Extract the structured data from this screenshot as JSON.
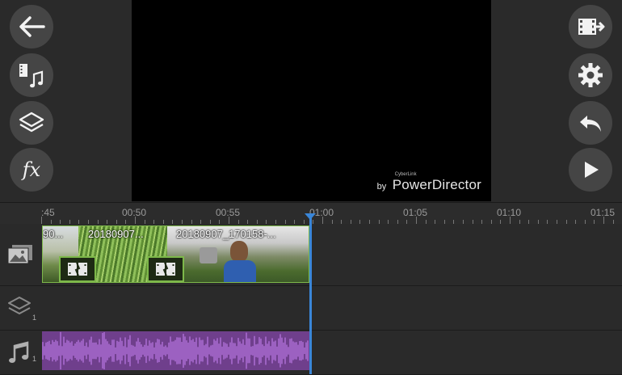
{
  "toolbar_left": {
    "buttons": [
      {
        "icon": "back-arrow-icon"
      },
      {
        "icon": "media-music-icon"
      },
      {
        "icon": "layers-icon"
      },
      {
        "icon": "fx-icon",
        "label": "fx"
      }
    ]
  },
  "toolbar_right": {
    "buttons": [
      {
        "icon": "export-film-icon"
      },
      {
        "icon": "gear-icon"
      },
      {
        "icon": "undo-icon"
      },
      {
        "icon": "play-icon"
      }
    ]
  },
  "preview": {
    "watermark_by": "by",
    "watermark_brand": "PowerDirector",
    "watermark_small": "CyberLink"
  },
  "ruler": {
    "labels": [
      ":45",
      "00:50",
      "00:55",
      "01:00",
      "01:05",
      "01:10",
      "01:15"
    ]
  },
  "video_track": {
    "clips": [
      {
        "title": "90..."
      },
      {
        "title": "20180907..."
      },
      {
        "title": "20180907_170158-..."
      }
    ]
  },
  "layer_track": {
    "count": "1"
  },
  "audio_track": {
    "count": "1"
  },
  "colors": {
    "video_clip_border": "#7db84a",
    "audio_clip": "#6f3f8c",
    "playhead": "#3a86d8"
  }
}
